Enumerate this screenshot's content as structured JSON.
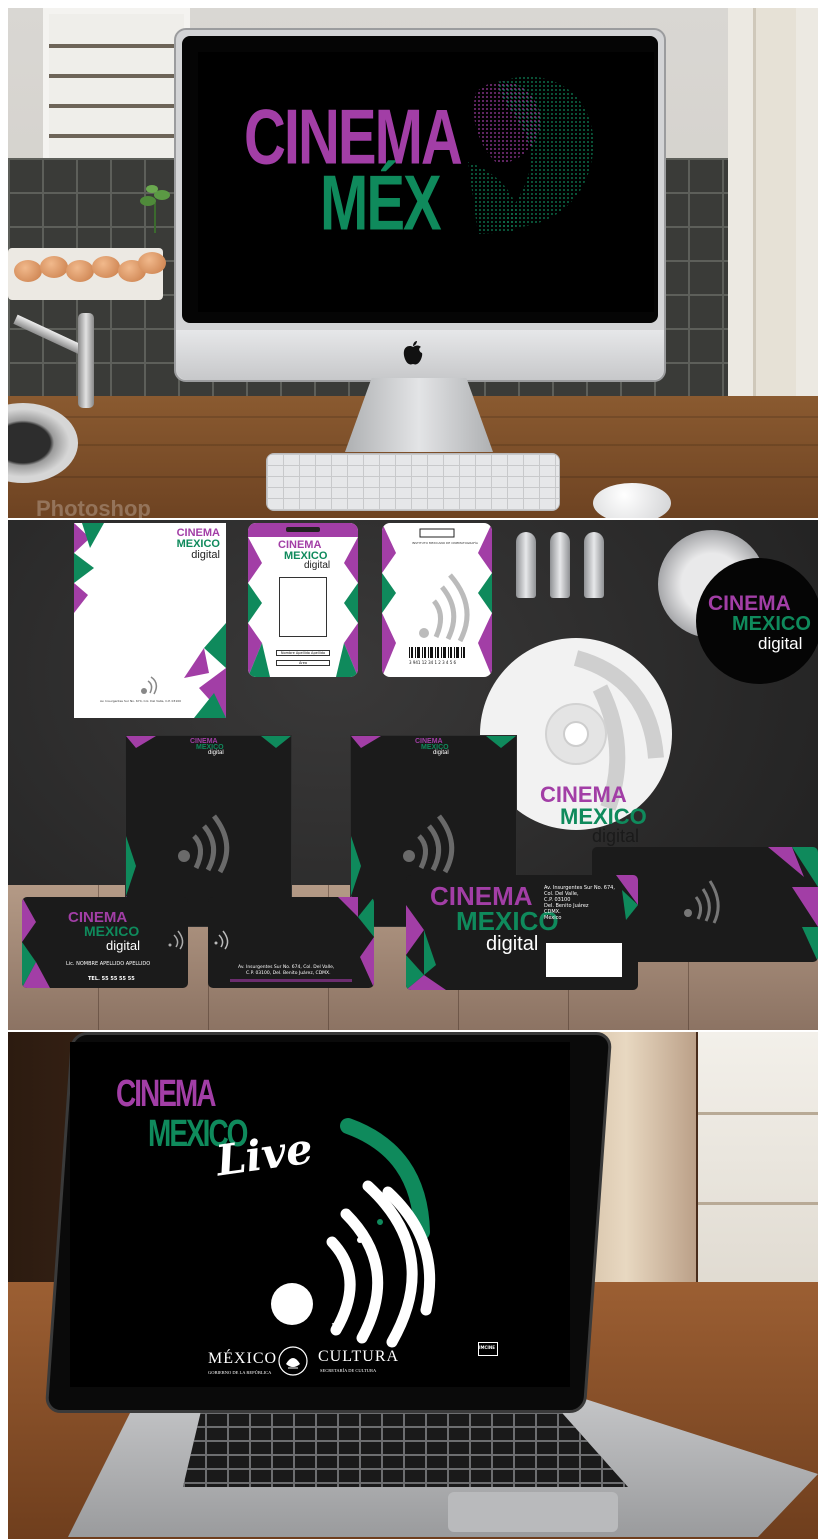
{
  "panel1": {
    "screen_title_line1": "CINEMA",
    "screen_title_line2": "MÉX",
    "background_watermark": "Photoshop"
  },
  "panel2": {
    "brand": {
      "line1": "CINEMA",
      "line2": "MEXICO",
      "line3": "digital"
    },
    "letterhead_footer": "Av. Insurgentes Sur No. 674, Col. Del Valle, C.P. 03100",
    "id_card_name_field": "Nombre Apellido Apellido",
    "id_card_area_field": "Área",
    "id_card_institute": "INSTITUTO MEXICANO DE CINEMATOGRAFÍA",
    "barcode_number": "3 941 12 34 1 2 3 4 5 6",
    "business_card_name": "Lic. NOMBRE APELLIDO APELLIDO",
    "business_card_tel": "TEL. 55 55 55 55",
    "business_card_back_address_line1": "Av. Insurgentes Sur No. 674, Col. Del Valle,",
    "business_card_back_address_line2": "C.P. 03100, Del. Benito Juárez, CDMX.",
    "envelope_address": [
      "Av. Insurgentes Sur No. 674,",
      "Col. Del Valle,",
      "C.P. 03100",
      "Del. Benito Juárez",
      "CDMX.",
      "México"
    ]
  },
  "panel3": {
    "brand": {
      "line1": "CINEMA",
      "line2": "MEXICO",
      "script": "Live"
    },
    "footer_left_title": "MÉXICO",
    "footer_left_sub": "GOBIERNO DE LA REPÚBLICA",
    "footer_center_title": "CULTURA",
    "footer_center_sub": "SECRETARÍA DE CULTURA",
    "footer_right_logo": "IMCINE"
  },
  "colors": {
    "purple": "#a23ea6",
    "green": "#0f8a5c",
    "white": "#ffffff",
    "screen_black": "#000000"
  }
}
